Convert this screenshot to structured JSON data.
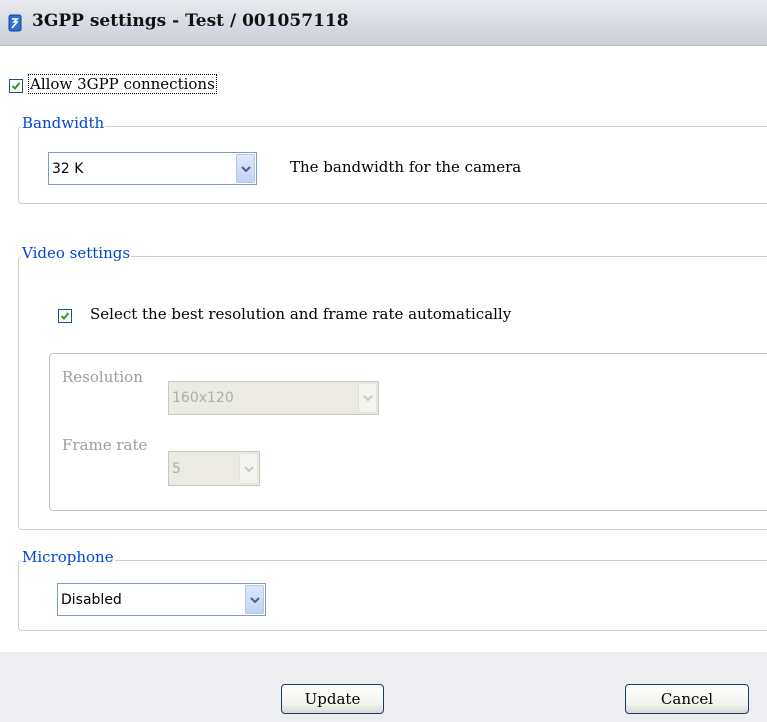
{
  "window": {
    "title": "3GPP settings - Test / 001057118"
  },
  "allow_3gpp": {
    "label": "Allow 3GPP connections",
    "checked": true
  },
  "bandwidth": {
    "legend": "Bandwidth",
    "selected": "32 K",
    "description": "The bandwidth for the camera"
  },
  "video": {
    "legend": "Video settings",
    "auto_label": "Select the best resolution and frame rate automatically",
    "auto_checked": true,
    "resolution_label": "Resolution",
    "resolution_value": "160x120",
    "frame_rate_label": "Frame rate",
    "frame_rate_value": "5"
  },
  "microphone": {
    "legend": "Microphone",
    "selected": "Disabled"
  },
  "buttons": {
    "update": "Update",
    "cancel": "Cancel"
  },
  "colors": {
    "legend_text": "#0046d5",
    "checkmark": "#21a121",
    "title_bar": "#d7dbe3"
  }
}
